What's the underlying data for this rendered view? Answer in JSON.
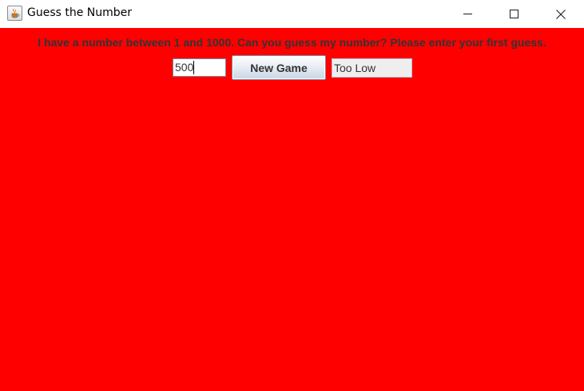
{
  "window": {
    "title": "Guess the Number",
    "icon": "java-coffee-cup-icon",
    "controls": [
      "minimize-icon",
      "maximize-icon",
      "close-icon"
    ]
  },
  "game": {
    "prompt": "I have a number between 1 and 1000. Can you guess my number?  Please enter your first guess.",
    "guess_value": "500",
    "new_game_label": "New Game",
    "status_text": "Too Low"
  },
  "colors": {
    "background": "#ff0000",
    "text": "#333333",
    "button_gradient_top": "#ffffff",
    "button_gradient_bottom": "#c9d6e4"
  }
}
